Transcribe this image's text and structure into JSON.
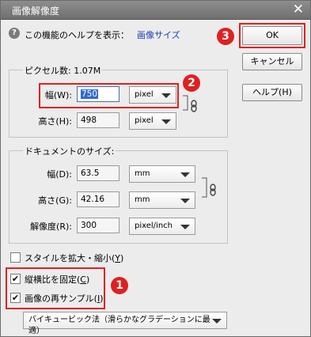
{
  "window": {
    "title": "画像解像度",
    "close_label": "✕"
  },
  "help_line": {
    "text": "この機能のヘルプを表示：",
    "link": "画像サイズ"
  },
  "buttons": {
    "ok": "OK",
    "cancel": "キャンセル",
    "help": "ヘルプ(",
    "help_key": "H",
    "help_end": ")"
  },
  "badges": {
    "one": "1",
    "two": "2",
    "three": "3"
  },
  "pixel_size": {
    "title": "ピクセル数: 1.07M",
    "width_label": "幅(W):",
    "width_value": "750",
    "width_unit": "pixel",
    "height_label": "高さ(H):",
    "height_value": "498",
    "height_unit": "pixel"
  },
  "document_size": {
    "title": "ドキュメントのサイズ:",
    "width_label": "幅(D):",
    "width_value": "63.5",
    "width_unit": "mm",
    "height_label": "高さ(G):",
    "height_value": "42.16",
    "height_unit": "mm",
    "resolution_label": "解像度(R):",
    "resolution_value": "300",
    "resolution_unit": "pixel/inch"
  },
  "options": {
    "scale_styles": {
      "label": "スタイルを拡大・縮小(",
      "key": "Y",
      "end": ")",
      "checked": false
    },
    "constrain": {
      "label": "縦横比を固定(",
      "key": "C",
      "end": ")",
      "checked": true
    },
    "resample": {
      "label": "画像の再サンプル(",
      "key": "I",
      "end": ")",
      "checked": true
    },
    "method": "バイキュービック法（滑らかなグラデーションに最適）"
  },
  "accent_color": "#e02020"
}
